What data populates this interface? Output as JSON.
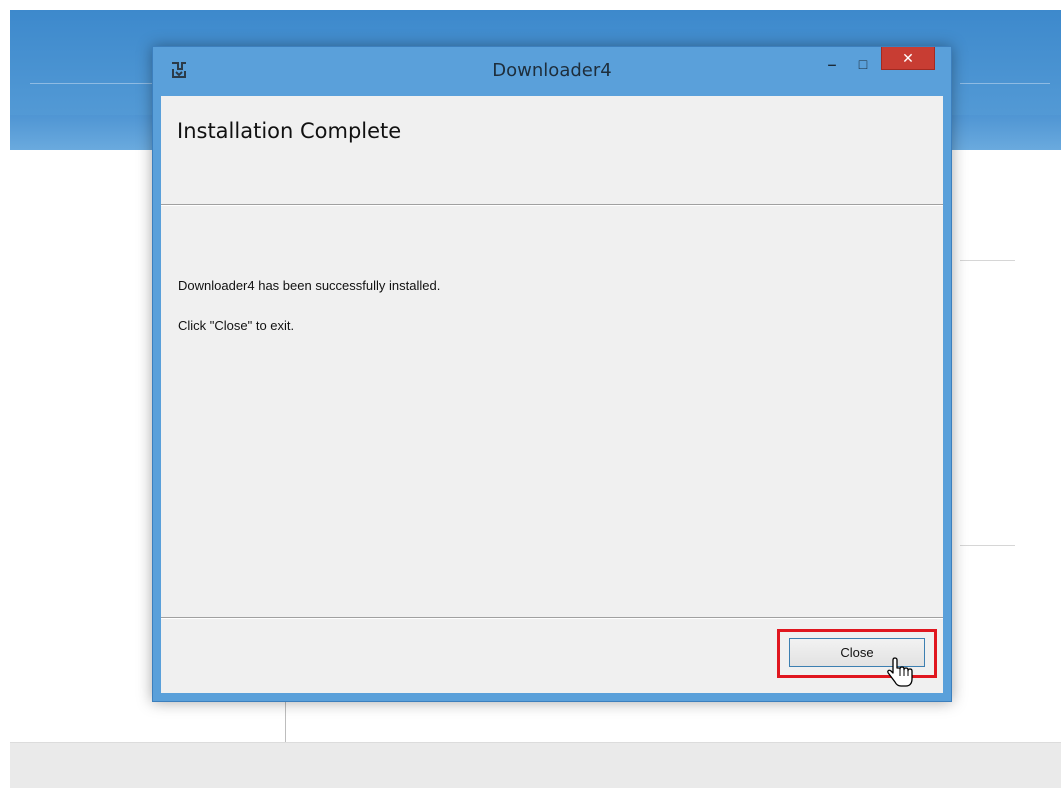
{
  "window": {
    "title": "Downloader4",
    "app_icon": "downloader-app-icon",
    "controls": {
      "minimize_icon": "minimize-icon",
      "maximize_icon": "maximize-icon",
      "close_icon": "close-icon",
      "minimize_glyph": "‒",
      "maximize_glyph": "□",
      "close_glyph": "✕"
    }
  },
  "header": {
    "title": "Installation Complete"
  },
  "body": {
    "line1": "Downloader4 has been successfully installed.",
    "line2": "Click \"Close\" to exit."
  },
  "footer": {
    "close_label": "Close"
  },
  "colors": {
    "titlebar": "#5aa0da",
    "close_button_red": "#c83d33",
    "highlight": "#e0171f",
    "client_bg": "#f0f0f0"
  },
  "cursor_icon": "hand-pointer-icon"
}
